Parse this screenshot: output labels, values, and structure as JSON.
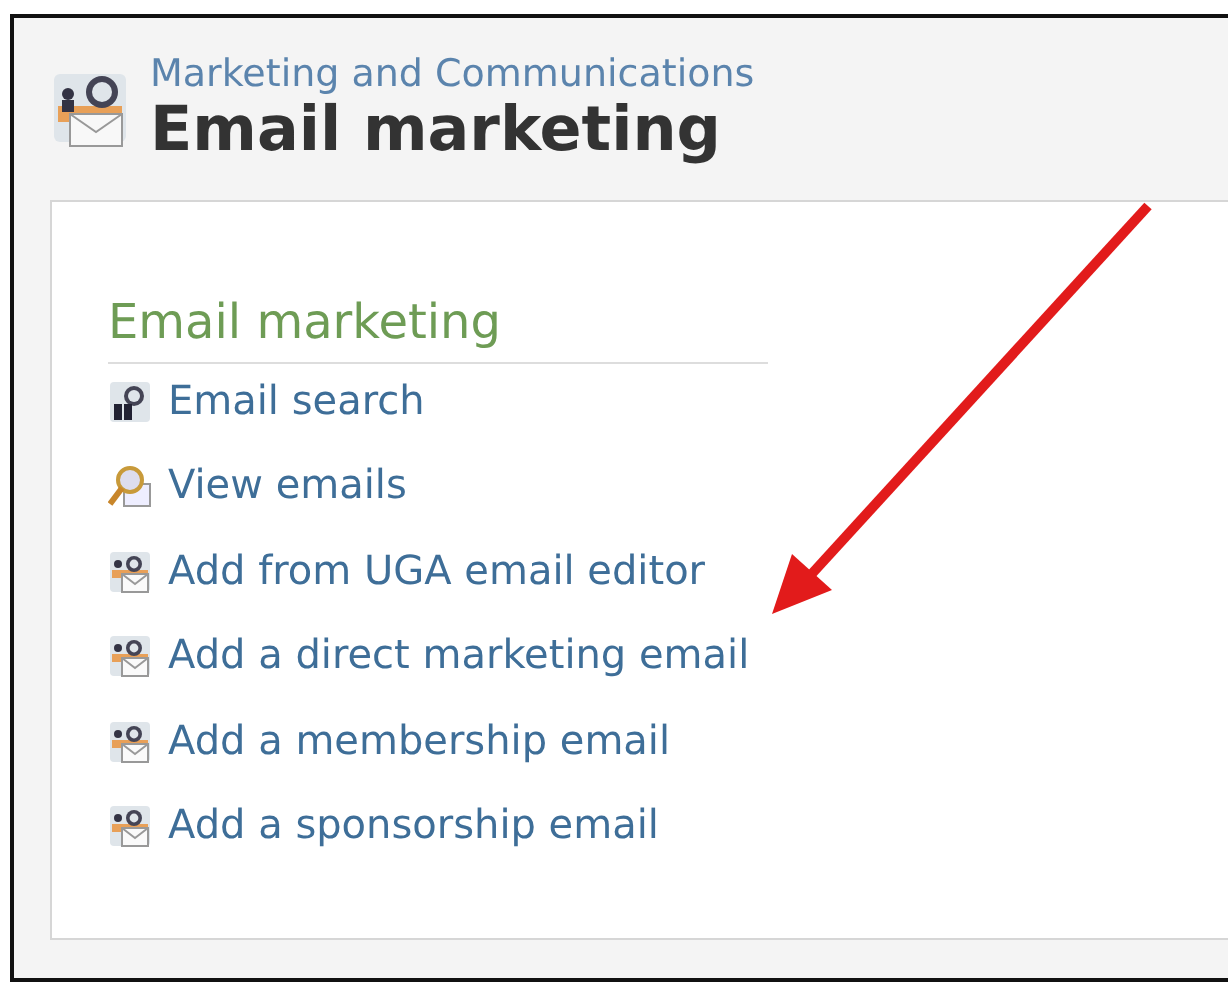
{
  "header": {
    "subtitle": "Marketing and Communications",
    "title": "Email marketing"
  },
  "section": {
    "heading": "Email marketing",
    "links": [
      {
        "label": "Email search",
        "kind": "search"
      },
      {
        "label": "View emails",
        "kind": "view"
      },
      {
        "label": "Add from UGA email editor",
        "kind": "add"
      },
      {
        "label": "Add a direct marketing email",
        "kind": "add"
      },
      {
        "label": "Add a membership email",
        "kind": "add"
      },
      {
        "label": "Add a sponsorship email",
        "kind": "add"
      }
    ]
  }
}
